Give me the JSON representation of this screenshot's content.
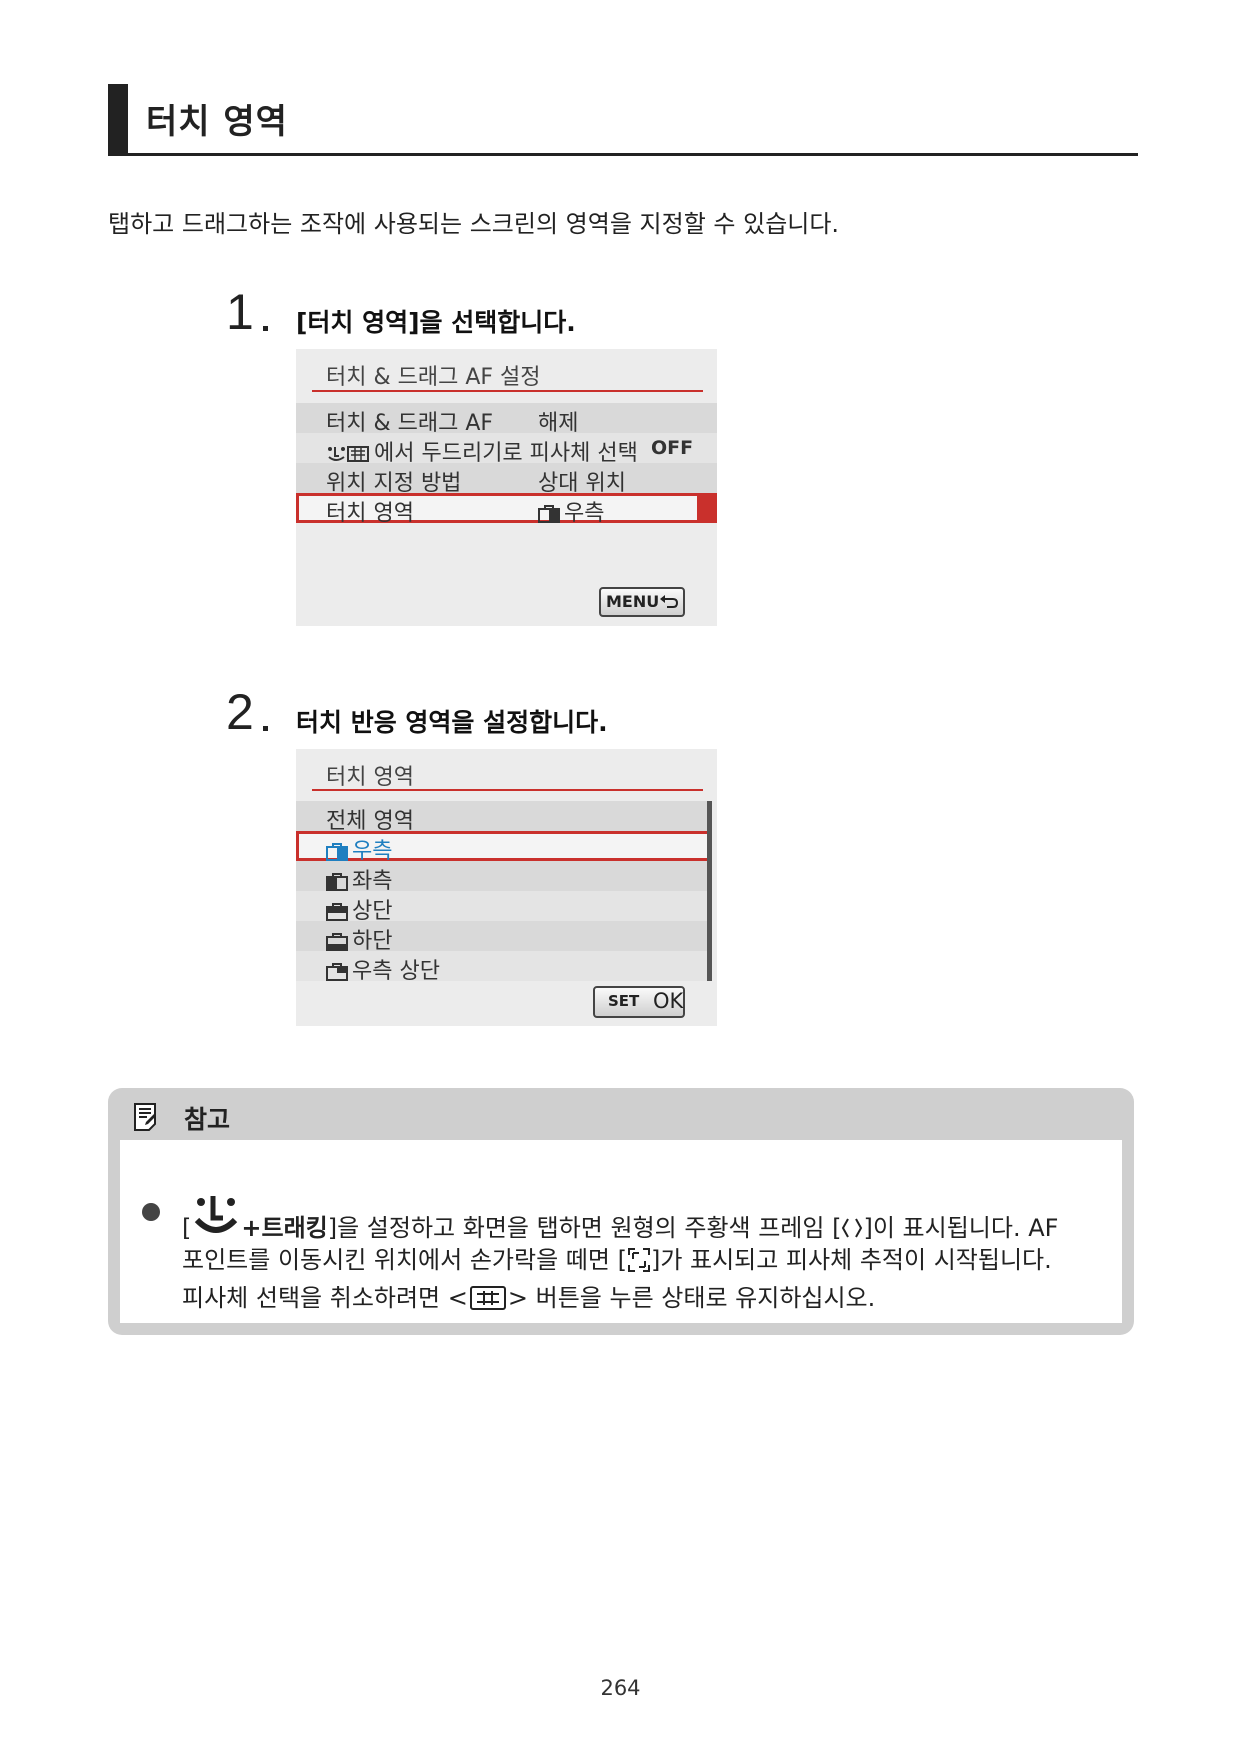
{
  "section": {
    "title": "터치 영역"
  },
  "intro": "탭하고 드래그하는 조작에 사용되는 스크린의 영역을 지정할 수 있습니다.",
  "steps": [
    {
      "number": "1",
      "text": "[터치 영역]을 선택합니다."
    },
    {
      "number": "2",
      "text": "터치 반응 영역을 설정합니다."
    }
  ],
  "screen1": {
    "header": "터치 & 드래그 AF 설정",
    "rows": [
      {
        "label": "터치 & 드래그 AF",
        "value": "해제"
      },
      {
        "label": "에서 두드리기로 피사체 선택",
        "value": "OFF"
      },
      {
        "label": "위치 지정 방법",
        "value": "상대 위치"
      },
      {
        "label": "터치 영역",
        "value": "우측"
      }
    ],
    "button": "MENU"
  },
  "screen2": {
    "header": "터치 영역",
    "options": [
      "전체 영역",
      "우측",
      "좌측",
      "상단",
      "하단",
      "우측 상단"
    ],
    "button_set": "SET",
    "button_ok": "OK"
  },
  "note": {
    "title": "참고",
    "line1_open": "[",
    "line1_bold": "+트래킹",
    "line1_rest": "]을 설정하고 화면을 탭하면 원형의 주황색 프레임 [",
    "line1_end": "]이 표시됩니다. AF",
    "line2_start": "포인트를 이동시킨 위치에서 손가락을 떼면 [",
    "line2_end": "]가 표시되고 피사체 추적이 시작됩니다.",
    "line3_start": "피사체 선택을 취소하려면 <",
    "line3_end": "> 버튼을 누른 상태로 유지하십시오."
  },
  "page_number": "264"
}
